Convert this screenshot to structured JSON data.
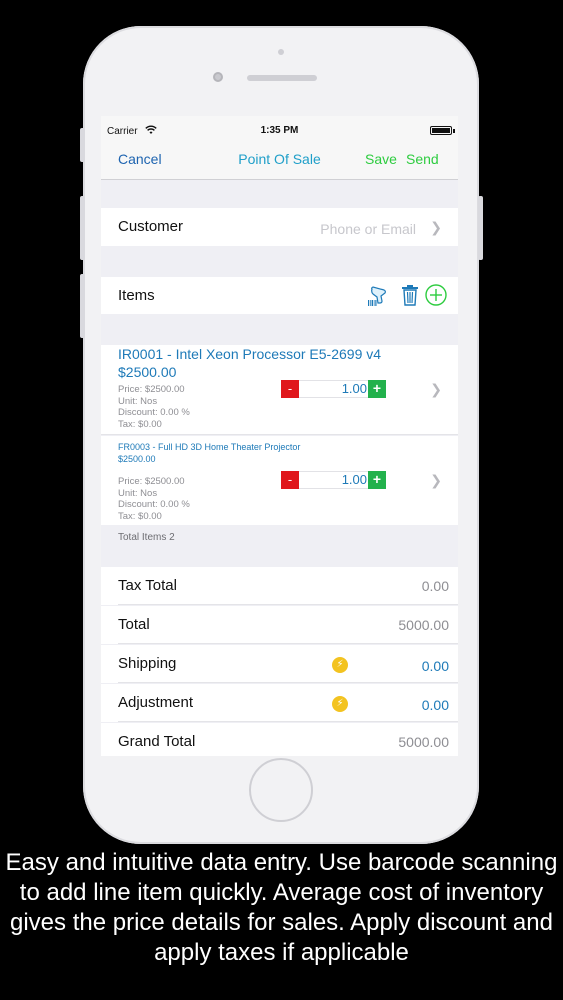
{
  "statusbar": {
    "carrier": "Carrier",
    "time": "1:35 PM"
  },
  "navbar": {
    "cancel": "Cancel",
    "title": "Point Of Sale",
    "save": "Save",
    "send": "Send"
  },
  "customer": {
    "label": "Customer",
    "placeholder": "Phone or Email"
  },
  "items_section": {
    "label": "Items",
    "icons": [
      "barcode-scan-icon",
      "trash-icon",
      "add-circle-icon"
    ]
  },
  "line_items": [
    {
      "title": "IR0001 - Intel Xeon Processor E5-2699 v4",
      "amount": "$2500.00",
      "price": "Price: $2500.00",
      "unit": "Unit: Nos",
      "discount": "Discount: 0.00 %",
      "tax": "Tax: $0.00",
      "quantity": "1.00"
    },
    {
      "title": "FR0003 - Full HD 3D Home Theater Projector",
      "amount": "$2500.00",
      "price": "Price: $2500.00",
      "unit": "Unit: Nos",
      "discount": "Discount: 0.00 %",
      "tax": "Tax: $0.00",
      "quantity": "1.00"
    }
  ],
  "total_items": "Total Items 2",
  "summary": {
    "tax_total_label": "Tax Total",
    "tax_total": "0.00",
    "total_label": "Total",
    "total": "5000.00",
    "shipping_label": "Shipping",
    "shipping": "0.00",
    "adjustment_label": "Adjustment",
    "adjustment": "0.00",
    "grand_total_label": "Grand Total",
    "grand_total": "5000.00"
  },
  "caption": "Easy and intuitive data entry. Use barcode scanning to add line item quickly. Average cost of inventory gives the price details for sales. Apply discount and apply taxes if applicable",
  "colors": {
    "accent_blue": "#1e7ab8",
    "title_blue": "#1f9fc9",
    "action_green": "#2ecc40",
    "minus_red": "#e0171c",
    "plus_green": "#22b14c",
    "coin_yellow": "#f3c320"
  }
}
